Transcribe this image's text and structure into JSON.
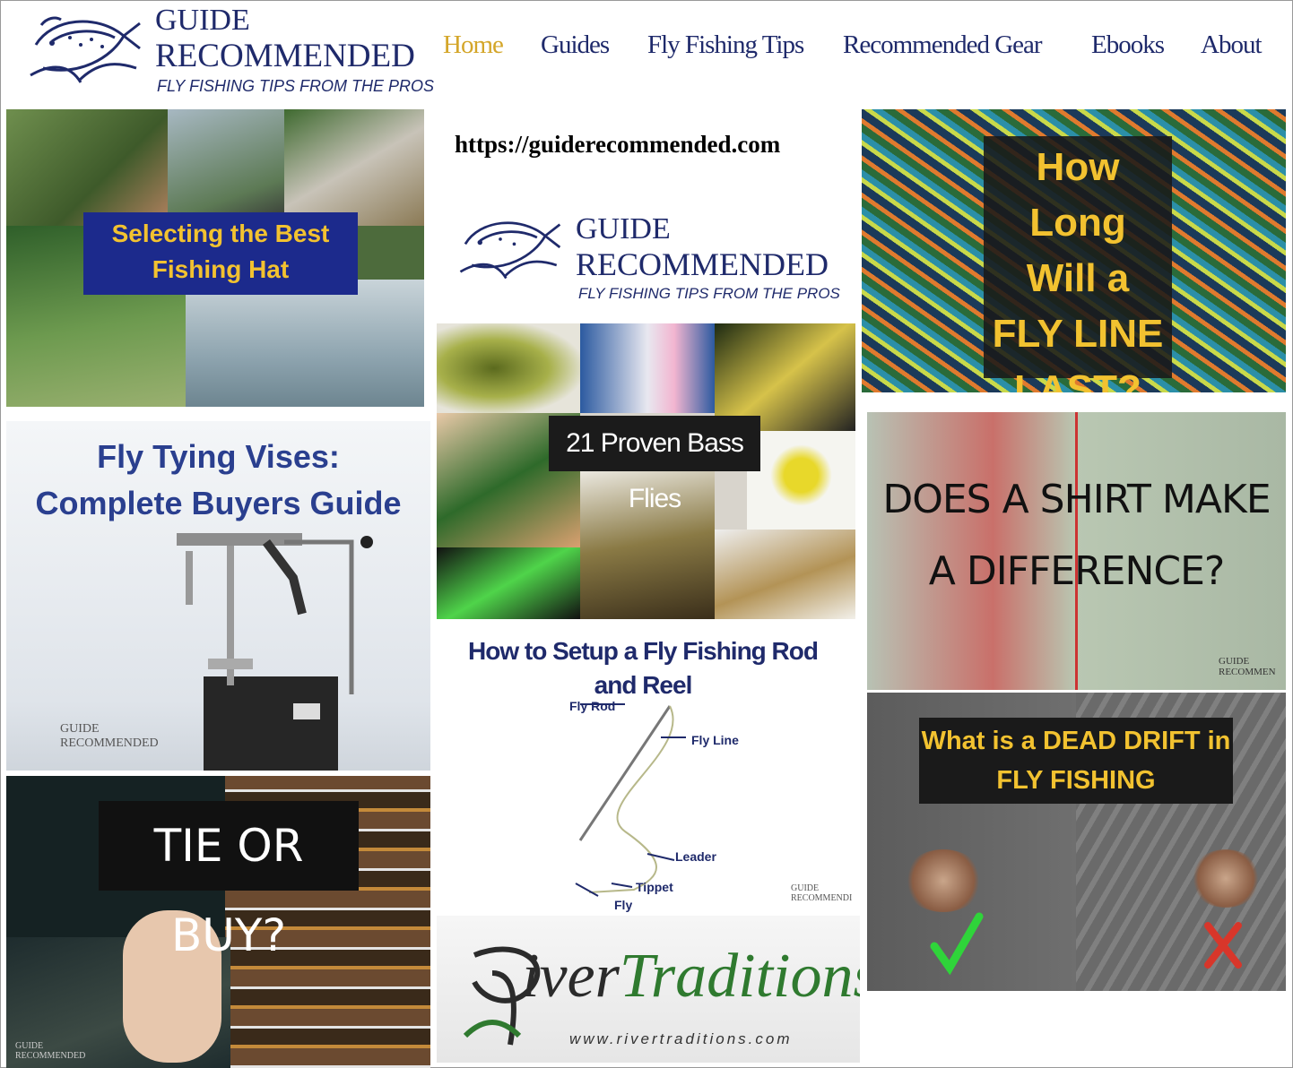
{
  "header": {
    "logo_line1": "GUIDE",
    "logo_line2": "RECOMMENDED",
    "logo_tagline": "FLY FISHING TIPS FROM THE PROS"
  },
  "nav": {
    "items": [
      {
        "label": "Home",
        "active": true
      },
      {
        "label": "Guides"
      },
      {
        "label": "Fly Fishing Tips"
      },
      {
        "label": "Recommended Gear"
      },
      {
        "label": "Ebooks"
      },
      {
        "label": "About"
      }
    ]
  },
  "center": {
    "url": "https://guiderecommended.com",
    "logo_line1": "GUIDE",
    "logo_line2": "RECOMMENDED",
    "logo_tagline": "FLY FISHING TIPS FROM THE PROS"
  },
  "tiles": {
    "hat": {
      "title_line1": "Selecting the Best",
      "title_line2": "Fishing Hat"
    },
    "fly_line": {
      "l1": "How Long",
      "l2": "Will a",
      "l3": "FLY LINE",
      "l4": "LAST?"
    },
    "vises": {
      "l1": "Fly Tying Vises:",
      "l2": "Complete Buyers Guide",
      "wm1": "GUIDE",
      "wm2": "RECOMMENDED"
    },
    "bass": {
      "title": "21 Proven Bass Flies"
    },
    "shirt": {
      "l1": "DOES A SHIRT MAKE",
      "l2": "A DIFFERENCE?",
      "wm1": "GUIDE",
      "wm2": "RECOMMEN"
    },
    "setup": {
      "l1": "How to Setup a Fly Fishing Rod",
      "l2": "and Reel",
      "labels": [
        "Fly Rod",
        "Fly Line",
        "Leader",
        "Tippet",
        "Fly"
      ],
      "wm1": "GUIDE",
      "wm2": "RECOMMENDI"
    },
    "dead_drift": {
      "l1": "What is a DEAD DRIFT in",
      "l2": "FLY FISHING"
    },
    "tie": {
      "title": "TIE OR BUY?",
      "wm1": "GUIDE",
      "wm2": "RECOMMENDED"
    },
    "river": {
      "brand1": "iver",
      "brand2": "Traditions",
      "url": "www.rivertraditions.com"
    }
  },
  "colors": {
    "navy": "#1f2a6b",
    "gold": "#d4a62a",
    "banner_blue": "#1c2a8c",
    "banner_yellow": "#f2c230"
  }
}
